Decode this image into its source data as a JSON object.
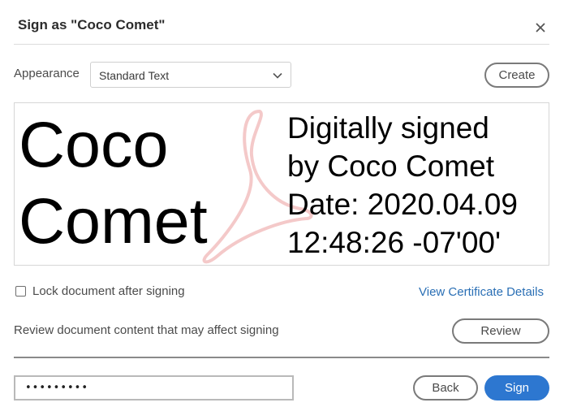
{
  "dialog": {
    "title": "Sign as \"Coco Comet\"",
    "close_icon": "close-icon"
  },
  "appearance": {
    "label": "Appearance",
    "selected": "Standard Text",
    "create_label": "Create"
  },
  "preview": {
    "name_lines": [
      "Coco",
      "Comet"
    ],
    "detail_lines": [
      "Digitally signed",
      "by Coco Comet",
      "Date: 2020.04.09",
      "12:48:26 -07'00'"
    ],
    "watermark_icon": "acrobat-logo-icon"
  },
  "options": {
    "lock_label": "Lock document after signing",
    "lock_checked": false,
    "cert_link": "View Certificate Details",
    "review_text": "Review document content that may affect signing",
    "review_label": "Review"
  },
  "footer": {
    "password_value": "•••••••••",
    "back_label": "Back",
    "sign_label": "Sign"
  },
  "colors": {
    "accent": "#2d77d0",
    "link": "#2a6fb5",
    "watermark": "#f4c9c9"
  }
}
